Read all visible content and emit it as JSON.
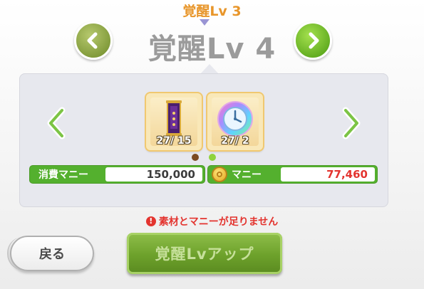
{
  "header": {
    "current_level": "覚醒Lv 3",
    "next_level": "覚醒Lv 4"
  },
  "navigation": {
    "prev_icon": "chevron-left-icon",
    "next_icon": "chevron-right-icon"
  },
  "materials": [
    {
      "icon": "purple-scroll-icon",
      "count": "27/ 15"
    },
    {
      "icon": "rainbow-clock-icon",
      "count": "27/ 2"
    }
  ],
  "cost": {
    "label": "消費マニー",
    "value": "150,000"
  },
  "money": {
    "label": "マニー",
    "value": "77,460",
    "icon": "coin-icon"
  },
  "warning": "素材とマニーが足りません",
  "buttons": {
    "back_label": "戻る",
    "awaken_label": "覚醒Lvアップ"
  },
  "colors": {
    "accent_orange": "#e8962b",
    "green": "#54b02e",
    "warning_red": "#e3342f"
  }
}
